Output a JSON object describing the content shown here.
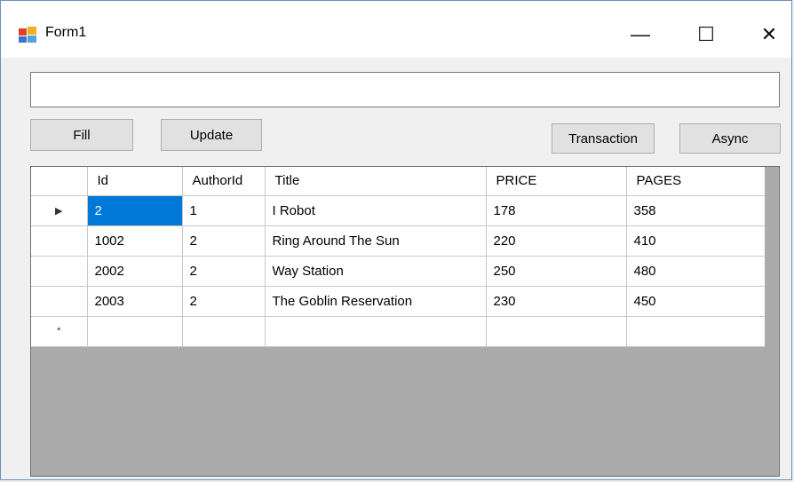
{
  "window": {
    "title": "Form1",
    "min_glyph": "—",
    "max_glyph": "☐",
    "close_glyph": "✕"
  },
  "textbox": {
    "value": ""
  },
  "buttons": {
    "fill": "Fill",
    "update": "Update",
    "transaction": "Transaction",
    "async": "Async"
  },
  "grid": {
    "columns": [
      "Id",
      "AuthorId",
      "Title",
      "PRICE",
      "PAGES"
    ],
    "rows": [
      {
        "marker": "▶",
        "cells": [
          "2",
          "1",
          "I Robot",
          "178",
          "358"
        ]
      },
      {
        "marker": "",
        "cells": [
          "1002",
          "2",
          "Ring Around The Sun",
          "220",
          "410"
        ]
      },
      {
        "marker": "",
        "cells": [
          "2002",
          "2",
          "Way Station",
          "250",
          "480"
        ]
      },
      {
        "marker": "",
        "cells": [
          "2003",
          "2",
          "The Goblin Reservation",
          "230",
          "450"
        ]
      },
      {
        "marker": "*",
        "cells": [
          "",
          "",
          "",
          "",
          ""
        ]
      }
    ]
  },
  "colors": {
    "selection": "#0078d7",
    "grid_background": "#ababab",
    "button_face": "#e1e1e1"
  }
}
